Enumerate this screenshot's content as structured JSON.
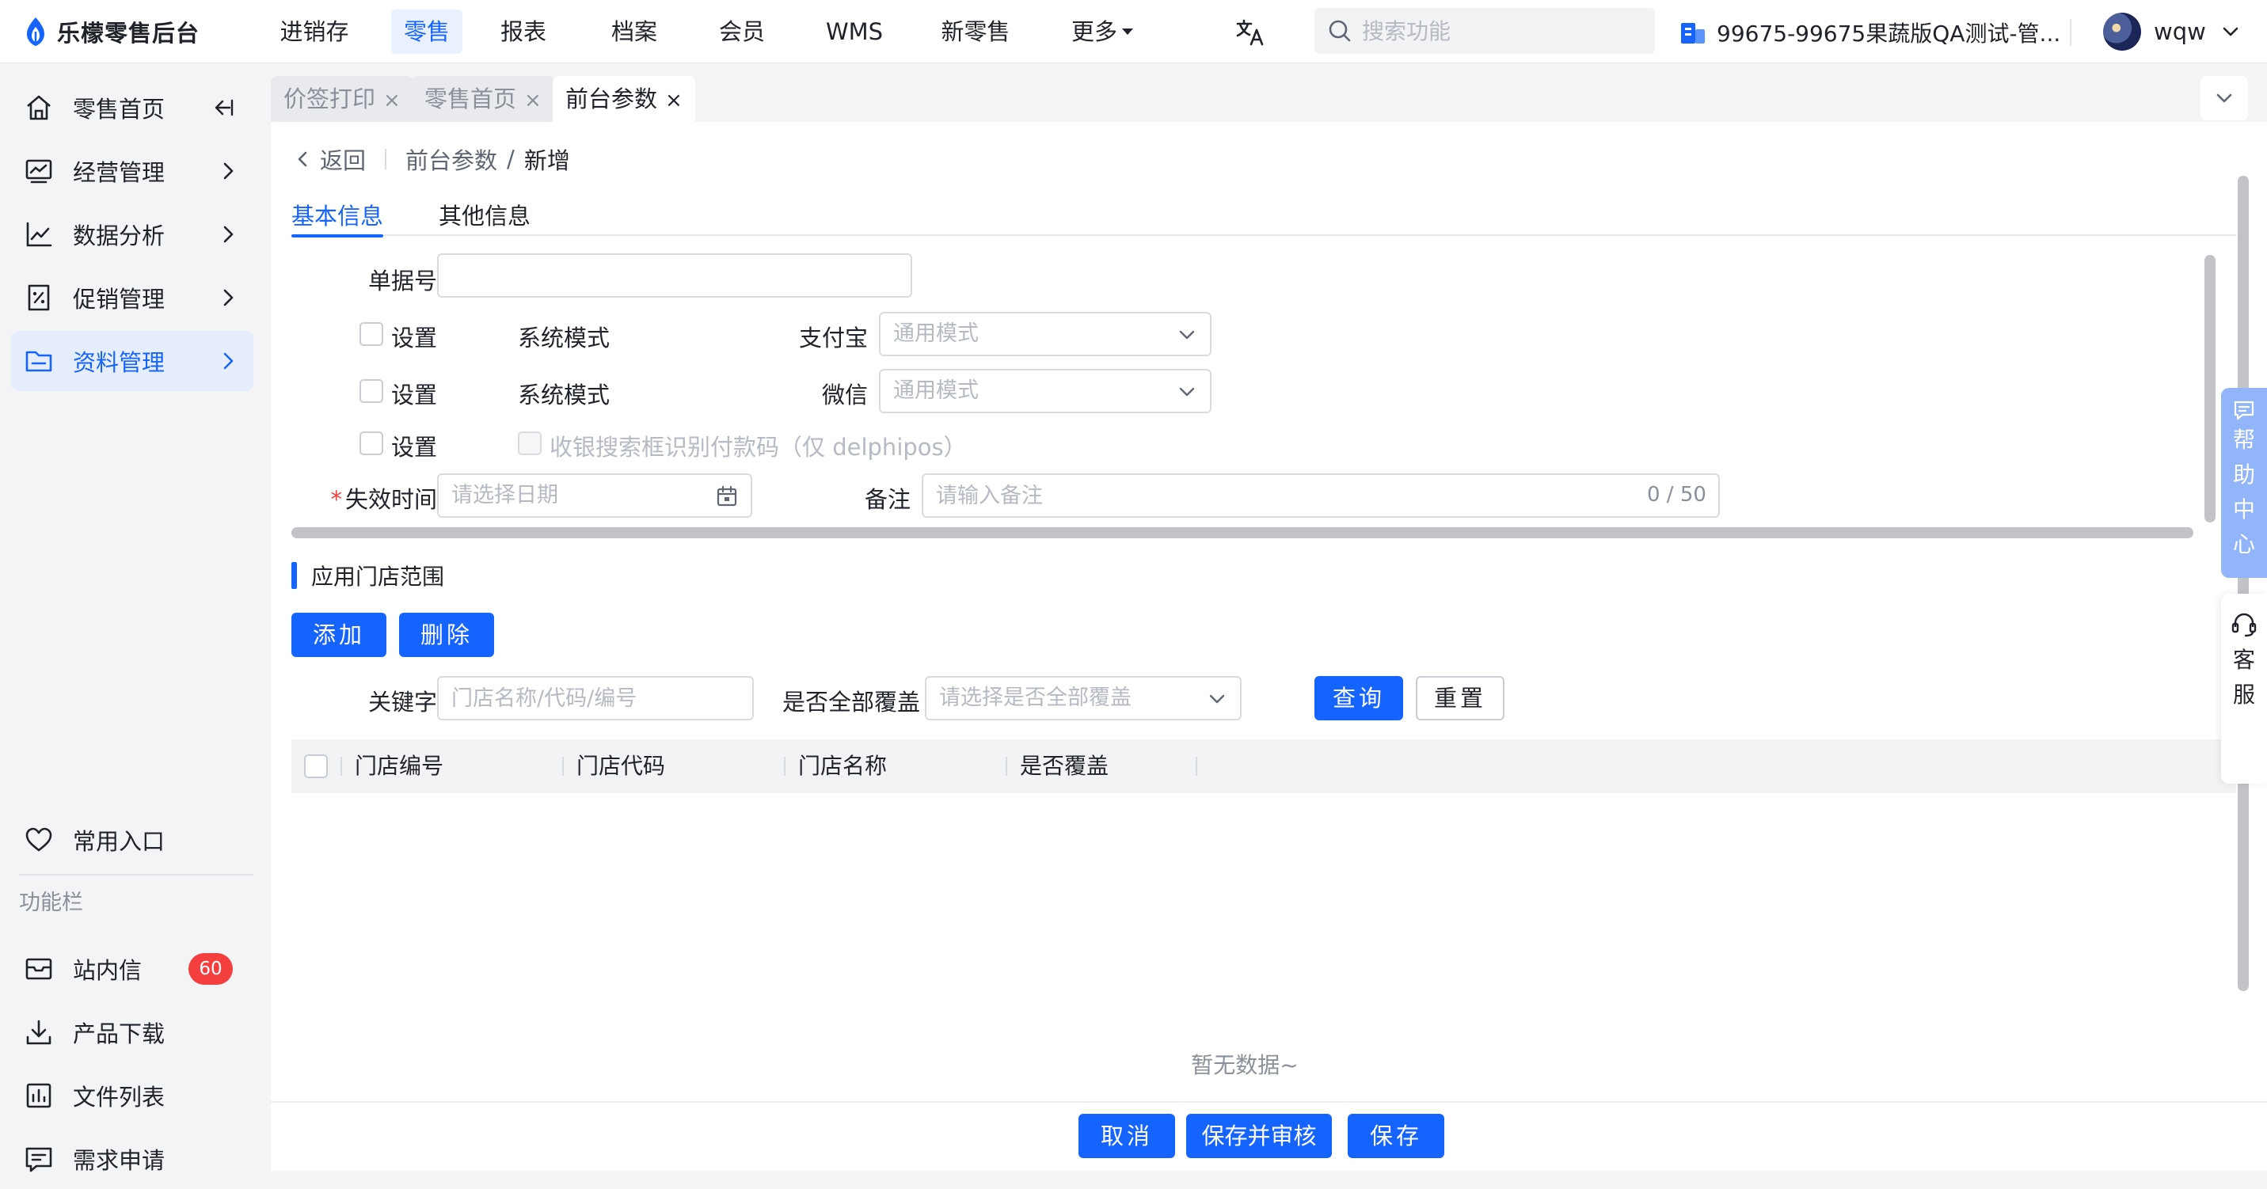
{
  "brand": {
    "name": "乐檬零售后台"
  },
  "topnav": {
    "menu": [
      {
        "label": "进销存",
        "active": false
      },
      {
        "label": "零售",
        "active": true
      },
      {
        "label": "报表",
        "active": false
      },
      {
        "label": "档案",
        "active": false
      },
      {
        "label": "会员",
        "active": false
      },
      {
        "label": "WMS",
        "active": false
      },
      {
        "label": "新零售",
        "active": false
      },
      {
        "label": "更多",
        "active": false
      }
    ],
    "search_placeholder": "搜索功能",
    "store": "99675-99675果蔬版QA测试-管...",
    "username": "wqw"
  },
  "sidebar": {
    "items": [
      {
        "label": "零售首页",
        "icon": "home-icon"
      },
      {
        "label": "经营管理",
        "icon": "monitor-icon"
      },
      {
        "label": "数据分析",
        "icon": "line-chart-icon"
      },
      {
        "label": "促销管理",
        "icon": "discount-icon"
      },
      {
        "label": "资料管理",
        "icon": "folder-icon",
        "active": true
      }
    ],
    "favorite": "常用入口",
    "group_label": "功能栏",
    "tools": [
      {
        "label": "站内信",
        "icon": "mail-icon",
        "badge": "60"
      },
      {
        "label": "产品下载",
        "icon": "download-icon"
      },
      {
        "label": "文件列表",
        "icon": "file-list-icon"
      },
      {
        "label": "需求申请",
        "icon": "request-icon"
      }
    ]
  },
  "tabs": [
    {
      "label": "价签打印",
      "close": "×",
      "active": false
    },
    {
      "label": "零售首页",
      "close": "×",
      "active": false
    },
    {
      "label": "前台参数",
      "close": "×",
      "active": true
    }
  ],
  "breadcrumb": {
    "back": "返回",
    "parent": "前台参数",
    "separator": "/",
    "current": "新增"
  },
  "form_tabs": [
    {
      "label": "基本信息",
      "active": true
    },
    {
      "label": "其他信息",
      "active": false
    }
  ],
  "form": {
    "doc_no_label": "单据号",
    "doc_no_value": "",
    "row1": {
      "checkbox_label": "设置",
      "mode_text": "系统模式",
      "field_label": "支付宝",
      "select_placeholder": "通用模式"
    },
    "row2": {
      "checkbox_label": "设置",
      "mode_text": "系统模式",
      "field_label": "微信",
      "select_placeholder": "通用模式"
    },
    "row3": {
      "checkbox_label": "设置",
      "option_text": "收银搜索框识别付款码（仅 delphipos）"
    },
    "expire_required_mark": "*",
    "expire_label": "失效时间",
    "expire_placeholder": "请选择日期",
    "remark_label": "备注",
    "remark_placeholder": "请输入备注",
    "remark_counter": "0 / 50"
  },
  "store_scope": {
    "title": "应用门店范围",
    "add_button": "添加",
    "delete_button": "删除",
    "keyword_label": "关键字",
    "keyword_placeholder": "门店名称/代码/编号",
    "cover_label": "是否全部覆盖",
    "cover_placeholder": "请选择是否全部覆盖",
    "query_button": "查询",
    "reset_button": "重置",
    "columns": [
      "门店编号",
      "门店代码",
      "门店名称",
      "是否覆盖"
    ],
    "empty_text": "暂无数据~"
  },
  "footer": {
    "cancel": "取消",
    "save_audit": "保存并审核",
    "save": "保存"
  },
  "floating": {
    "help": [
      "帮",
      "助",
      "中",
      "心"
    ],
    "service": [
      "客",
      "服"
    ]
  },
  "colors": {
    "primary": "#1664ff",
    "danger": "#f53f3f",
    "help_float": "#91b5f8"
  }
}
